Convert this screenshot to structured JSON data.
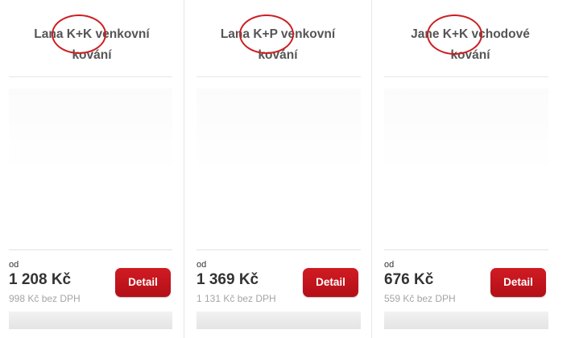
{
  "products": [
    {
      "title_line1": "Lana K+K venkovní",
      "title_line2": "kování",
      "price_prefix": "od",
      "price": "1 208 Kč",
      "price_net": "998 Kč bez DPH",
      "button_label": "Detail",
      "image_type": "lever-handle-plate"
    },
    {
      "title_line1": "Lana K+P venkovní",
      "title_line2": "kování",
      "price_prefix": "od",
      "price": "1 369 Kč",
      "price_net": "1 131 Kč bez DPH",
      "button_label": "Detail",
      "image_type": "knob-handle-plate"
    },
    {
      "title_line1": "Jane K+K vchodové",
      "title_line2": "kování",
      "price_prefix": "od",
      "price": "676 Kč",
      "price_net": "559 Kč bez DPH",
      "button_label": "Detail",
      "image_type": "lever-handle-narrow-plate"
    }
  ],
  "colors": {
    "accent": "#c8161e",
    "annotation": "#cc1f22",
    "title_text": "#555555",
    "price_text": "#333333",
    "net_text": "#a4a4a4"
  }
}
